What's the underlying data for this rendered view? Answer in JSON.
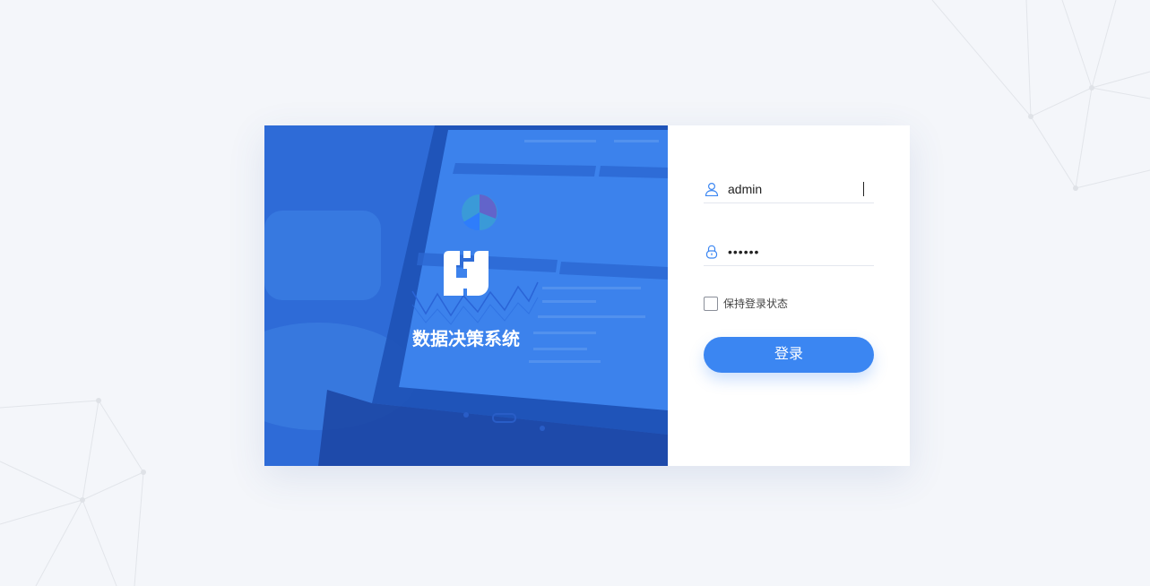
{
  "brand": {
    "title": "数据决策系统"
  },
  "login": {
    "username_value": "admin",
    "password_value": "••••••",
    "remember_label": "保持登录状态",
    "remember_checked": false,
    "submit_label": "登录"
  },
  "colors": {
    "primary": "#3b86f2",
    "hero_blue": "#2f6ed8",
    "background": "#f4f6fa"
  },
  "icons": [
    "user-icon",
    "lock-icon",
    "brand-logo-icon"
  ]
}
